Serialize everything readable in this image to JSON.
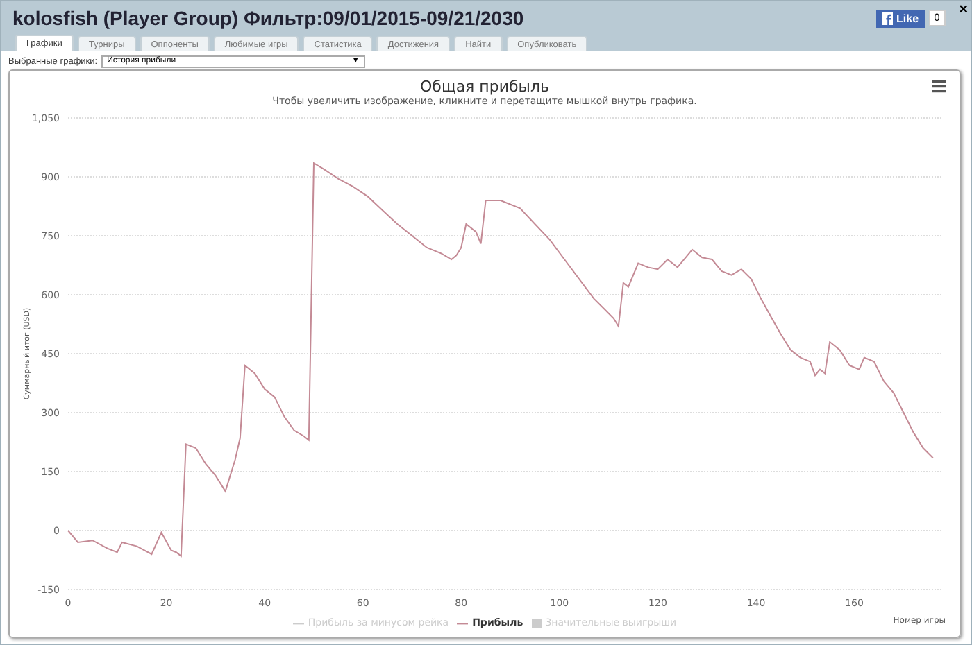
{
  "window": {
    "title": "kolosfish (Player Group) Фильтр:09/01/2015-09/21/2030",
    "like_label": "Like",
    "like_count": "0",
    "close": "×"
  },
  "tabs": [
    {
      "label": "Графики",
      "selected": true
    },
    {
      "label": "Турниры",
      "selected": false
    },
    {
      "label": "Оппоненты",
      "selected": false
    },
    {
      "label": "Любимые игры",
      "selected": false
    },
    {
      "label": "Статистика",
      "selected": false
    },
    {
      "label": "Достижения",
      "selected": false
    },
    {
      "label": "Найти",
      "selected": false
    },
    {
      "label": "Опубликовать",
      "selected": false
    }
  ],
  "graph_select": {
    "label": "Выбранные графики:",
    "value": "История прибыли",
    "caret": "▼"
  },
  "chart": {
    "subtitle": "Чтобы увеличить изображение, кликните и перетащите мышкой внутрь графика.",
    "legend": [
      {
        "label": "Прибыль за минусом рейка",
        "kind": "line",
        "enabled": false
      },
      {
        "kind": "series",
        "enabled": true
      },
      {
        "label": "Значительные выигрыши",
        "kind": "box",
        "enabled": false
      }
    ],
    "chart_data": {
      "type": "line",
      "title": "Общая прибыль",
      "xlabel": "Номер игры",
      "ylabel": "Суммарный итог (USD)",
      "x": [
        0,
        2,
        5,
        8,
        10,
        11,
        14,
        17,
        19,
        21,
        22,
        23,
        24,
        26,
        28,
        30,
        32,
        34,
        35,
        36,
        38,
        40,
        42,
        44,
        46,
        48,
        49,
        50,
        52,
        55,
        58,
        61,
        64,
        67,
        70,
        73,
        76,
        78,
        79,
        80,
        81,
        83,
        84,
        85,
        88,
        92,
        95,
        98,
        101,
        104,
        107,
        109,
        111,
        112,
        113,
        114,
        116,
        118,
        120,
        122,
        124,
        126,
        127,
        129,
        131,
        133,
        135,
        137,
        139,
        141,
        143,
        145,
        147,
        149,
        151,
        152,
        153,
        154,
        155,
        157,
        159,
        161,
        162,
        164,
        166,
        168,
        170,
        172,
        174,
        176
      ],
      "series": [
        {
          "name": "Прибыль",
          "color": "#c48a95",
          "values": [
            0,
            -30,
            -25,
            -45,
            -55,
            -30,
            -40,
            -60,
            -5,
            -50,
            -55,
            -65,
            220,
            210,
            170,
            140,
            100,
            180,
            235,
            420,
            400,
            360,
            340,
            290,
            255,
            240,
            230,
            935,
            920,
            895,
            875,
            850,
            815,
            780,
            750,
            720,
            705,
            690,
            700,
            720,
            780,
            760,
            730,
            840,
            840,
            820,
            780,
            740,
            690,
            640,
            590,
            565,
            540,
            520,
            630,
            620,
            680,
            670,
            665,
            690,
            670,
            700,
            715,
            695,
            690,
            660,
            650,
            665,
            640,
            590,
            545,
            500,
            460,
            440,
            430,
            395,
            410,
            400,
            480,
            460,
            420,
            410,
            440,
            430,
            380,
            350,
            300,
            250,
            210,
            185
          ]
        }
      ],
      "grid": true,
      "xlim": [
        0,
        178
      ],
      "ylim": [
        -150,
        1050
      ],
      "xticks": [
        0,
        20,
        40,
        60,
        80,
        100,
        120,
        140,
        160
      ],
      "yticks": [
        {
          "value": -150,
          "label": "-150"
        },
        {
          "value": 0,
          "label": "0"
        },
        {
          "value": 150,
          "label": "150"
        },
        {
          "value": 300,
          "label": "300"
        },
        {
          "value": 450,
          "label": "450"
        },
        {
          "value": 600,
          "label": "600"
        },
        {
          "value": 750,
          "label": "750"
        },
        {
          "value": 900,
          "label": "900"
        },
        {
          "value": 1050,
          "label": "1,050"
        }
      ]
    }
  }
}
